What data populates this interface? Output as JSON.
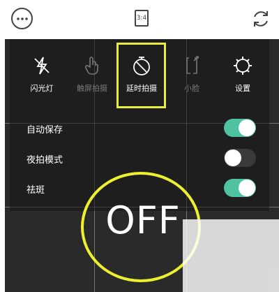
{
  "topbar": {
    "more_icon": "ellipsis-icon",
    "ratio_label": "3:4",
    "switch_icon": "switch-camera-icon"
  },
  "modes": [
    {
      "label": "闪光灯",
      "icon": "flash-off-icon",
      "enabled": true
    },
    {
      "label": "触屏拍摄",
      "icon": "touch-shoot-icon",
      "enabled": false
    },
    {
      "label": "延时拍摄",
      "icon": "timer-icon",
      "enabled": true,
      "highlighted": true
    },
    {
      "label": "小脸",
      "icon": "small-face-icon",
      "enabled": false
    },
    {
      "label": "设置",
      "icon": "settings-icon",
      "enabled": true
    }
  ],
  "toggles": [
    {
      "label": "自动保存",
      "on": true
    },
    {
      "label": "夜拍模式",
      "on": false
    },
    {
      "label": "祛斑",
      "on": true
    }
  ],
  "timer_state": "OFF",
  "colors": {
    "toggle_on": "#4fc3a1",
    "highlight": "#e8ec3a"
  }
}
